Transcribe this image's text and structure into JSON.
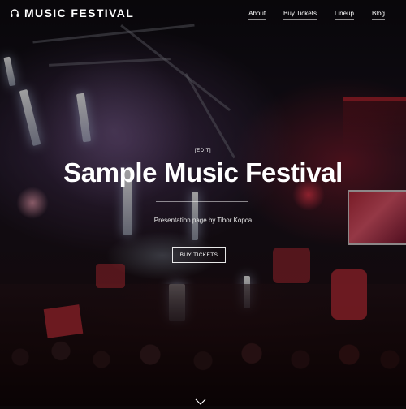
{
  "header": {
    "brand": "MUSIC FESTIVAL",
    "brand_icon": "headphones-icon",
    "nav": [
      "About",
      "Buy Tickets",
      "Lineup",
      "Blog"
    ]
  },
  "hero": {
    "edit_tag": "[EDIT]",
    "title": "Sample Music Festival",
    "subtitle": "Presentation page by Tibor Kopca",
    "cta_label": "BUY TICKETS",
    "scroll_icon": "chevron-down-icon",
    "background": "concert-stage-crowd-photo"
  },
  "colors": {
    "text": "#ffffff",
    "stage_red": "#c8303b",
    "stage_light": "#dce8ff"
  }
}
